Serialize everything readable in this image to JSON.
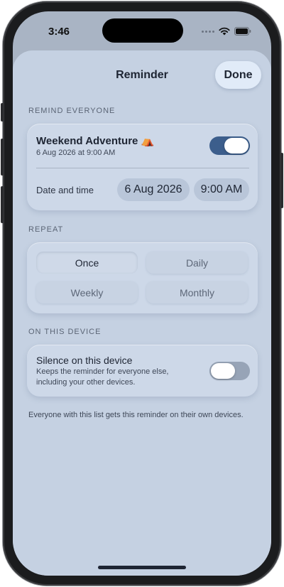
{
  "status": {
    "time": "3:46"
  },
  "header": {
    "title": "Reminder",
    "done_label": "Done"
  },
  "remind_everyone": {
    "section_label": "REMIND EVERYONE",
    "event_title": "Weekend Adventure ⛺",
    "event_subtitle": "6 Aug 2026 at 9:00 AM",
    "enabled": true,
    "date_time_label": "Date and time",
    "date_value": "6 Aug 2026",
    "time_value": "9:00 AM"
  },
  "repeat": {
    "section_label": "REPEAT",
    "options": [
      "Once",
      "Daily",
      "Weekly",
      "Monthly"
    ],
    "selected": "Once"
  },
  "device": {
    "section_label": "ON THIS DEVICE",
    "silence_title": "Silence on this device",
    "silence_description": "Keeps the reminder for everyone else, including your other devices.",
    "silenced": false
  },
  "footer_note": "Everyone with this list gets this reminder on their own devices.",
  "colors": {
    "accent": "#3c5e8c",
    "sheet": "#c5d1e2",
    "card": "#cdd8e8"
  }
}
